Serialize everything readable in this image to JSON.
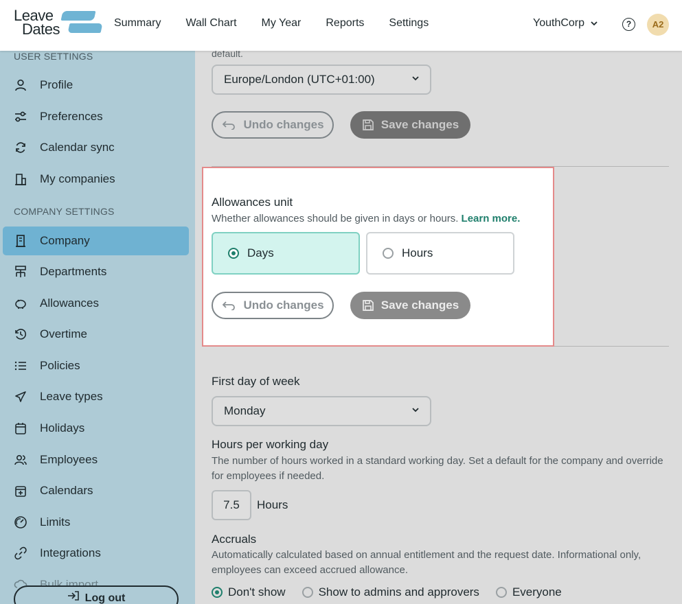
{
  "logo": {
    "line1": "Leave",
    "line2": "Dates"
  },
  "nav": {
    "items": [
      "Summary",
      "Wall Chart",
      "My Year",
      "Reports",
      "Settings"
    ]
  },
  "header": {
    "company": "YouthCorp",
    "help": "?",
    "avatar": "A2"
  },
  "sidebar": {
    "user_title": "USER SETTINGS",
    "company_title": "COMPANY SETTINGS",
    "user_items": [
      {
        "label": "Profile",
        "icon": "user-icon"
      },
      {
        "label": "Preferences",
        "icon": "sliders-icon"
      },
      {
        "label": "Calendar sync",
        "icon": "sync-icon"
      },
      {
        "label": "My companies",
        "icon": "buildings-icon"
      }
    ],
    "company_items": [
      {
        "label": "Company",
        "icon": "building-icon",
        "active": true
      },
      {
        "label": "Departments",
        "icon": "org-chart-icon"
      },
      {
        "label": "Allowances",
        "icon": "piggy-bank-icon"
      },
      {
        "label": "Overtime",
        "icon": "clock-rotate-icon"
      },
      {
        "label": "Policies",
        "icon": "list-icon"
      },
      {
        "label": "Leave types",
        "icon": "plane-icon"
      },
      {
        "label": "Holidays",
        "icon": "calendar-icon"
      },
      {
        "label": "Employees",
        "icon": "users-icon"
      },
      {
        "label": "Calendars",
        "icon": "calendar-plus-icon"
      },
      {
        "label": "Limits",
        "icon": "gauge-icon"
      },
      {
        "label": "Integrations",
        "icon": "link-icon"
      },
      {
        "label": "Bulk import",
        "icon": "upload-icon"
      }
    ],
    "logout": "Log out"
  },
  "main": {
    "faded_text": "default.",
    "timezone": "Europe/London (UTC+01:00)",
    "undo": "Undo changes",
    "save": "Save changes",
    "allowances": {
      "title": "Allowances unit",
      "desc": "Whether allowances should be given in days or hours.",
      "link": "Learn more.",
      "options": [
        "Days",
        "Hours"
      ],
      "selected": "Days"
    },
    "first_day": {
      "title": "First day of week",
      "value": "Monday"
    },
    "hours": {
      "title": "Hours per working day",
      "desc": "The number of hours worked in a standard working day. Set a default for the company and override for employees if needed.",
      "value": "7.5",
      "unit": "Hours"
    },
    "accruals": {
      "title": "Accruals",
      "desc": "Automatically calculated based on annual entitlement and the request date. Informational only, employees can exceed accrued allowance.",
      "options": [
        "Don't show",
        "Show to admins and approvers",
        "Everyone"
      ],
      "selected": "Don't show"
    }
  }
}
